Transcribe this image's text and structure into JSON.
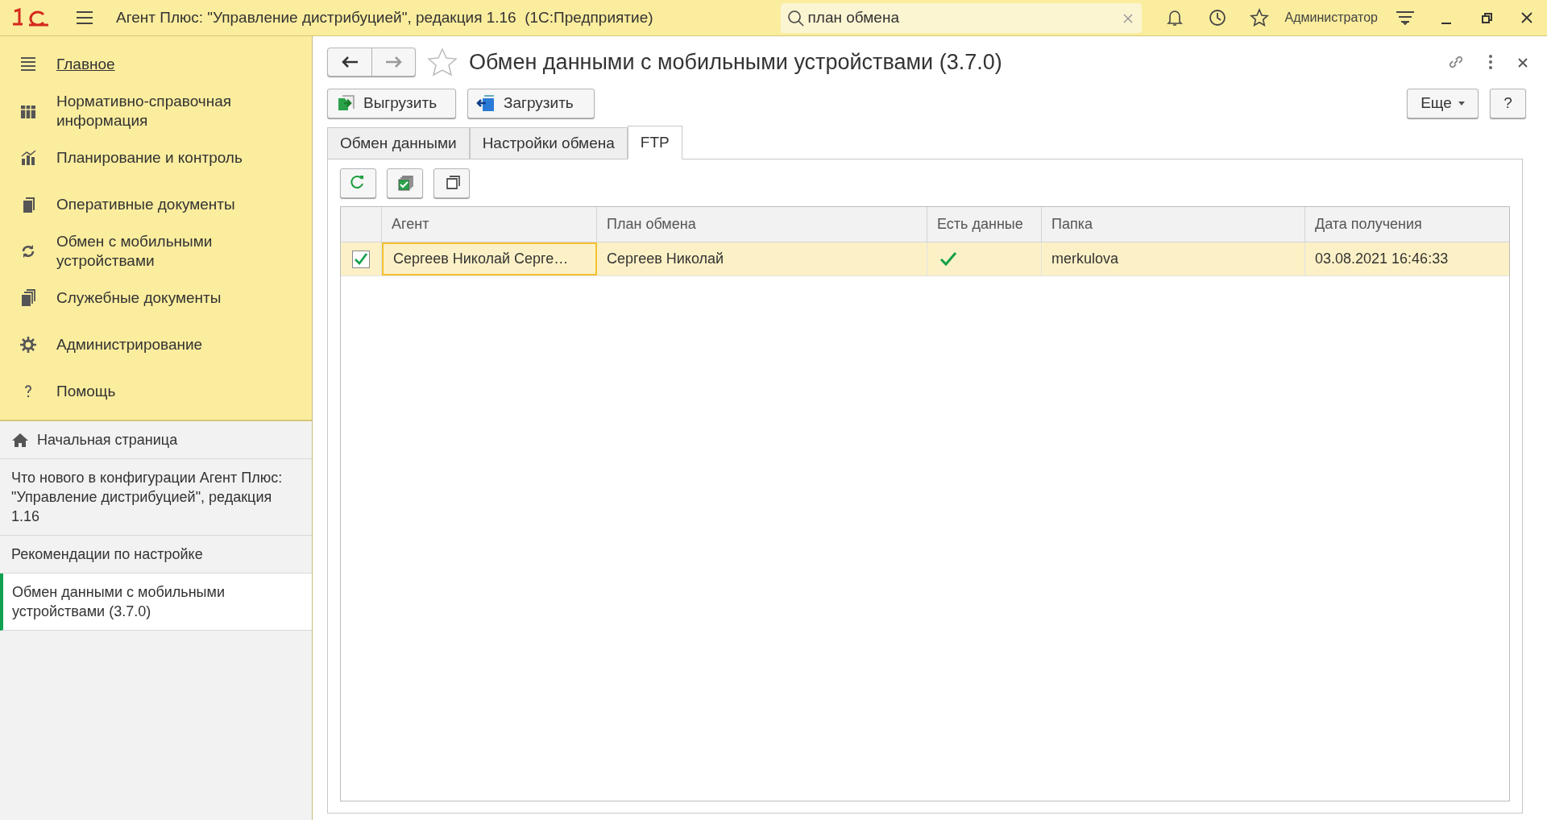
{
  "window": {
    "title": "Агент Плюс: \"Управление дистрибуцией\", редакция 1.16  (1С:Предприятие)",
    "search": {
      "value": "план обмена"
    },
    "user": "Администратор"
  },
  "sections": [
    {
      "label": "Главное",
      "selected": true
    },
    {
      "label": "Нормативно-справочная информация",
      "selected": false
    },
    {
      "label": "Планирование и контроль",
      "selected": false
    },
    {
      "label": "Оперативные документы",
      "selected": false
    },
    {
      "label": "Обмен с мобильными устройствами",
      "selected": false
    },
    {
      "label": "Служебные документы",
      "selected": false
    },
    {
      "label": "Администрирование",
      "selected": false
    },
    {
      "label": "Помощь",
      "selected": false
    }
  ],
  "open_windows": [
    {
      "label": "Начальная страница",
      "kind": "home",
      "selected": false
    },
    {
      "label": "Что нового в конфигурации Агент Плюс: \"Управление дистрибуцией\", редакция 1.16",
      "kind": "page",
      "selected": false
    },
    {
      "label": "Рекомендации по настройке",
      "kind": "page",
      "selected": false
    },
    {
      "label": "Обмен данными с мобильными устройствами (3.7.0)",
      "kind": "page",
      "selected": true
    }
  ],
  "form": {
    "title": "Обмен данными с мобильными устройствами (3.7.0)",
    "favorite": false,
    "buttons": [
      "Выгрузить",
      "Загрузить"
    ],
    "more_button": "Еще",
    "help_button": "?",
    "tabs": [
      {
        "label": "Обмен данными",
        "selected": false
      },
      {
        "label": "Настройки обмена",
        "selected": false
      },
      {
        "label": "FTP",
        "selected": true
      }
    ],
    "table": {
      "columns": [
        "Агент",
        "План обмена",
        "Есть данные",
        "Папка",
        "Дата получения"
      ],
      "rows": [
        {
          "checked": true,
          "selected": true,
          "agent": "Сергеев Николай Серге…",
          "plan": "Сергеев Николай",
          "has_data": true,
          "folder": "merkulova",
          "date": "03.08.2021 16:46:33"
        }
      ]
    }
  }
}
